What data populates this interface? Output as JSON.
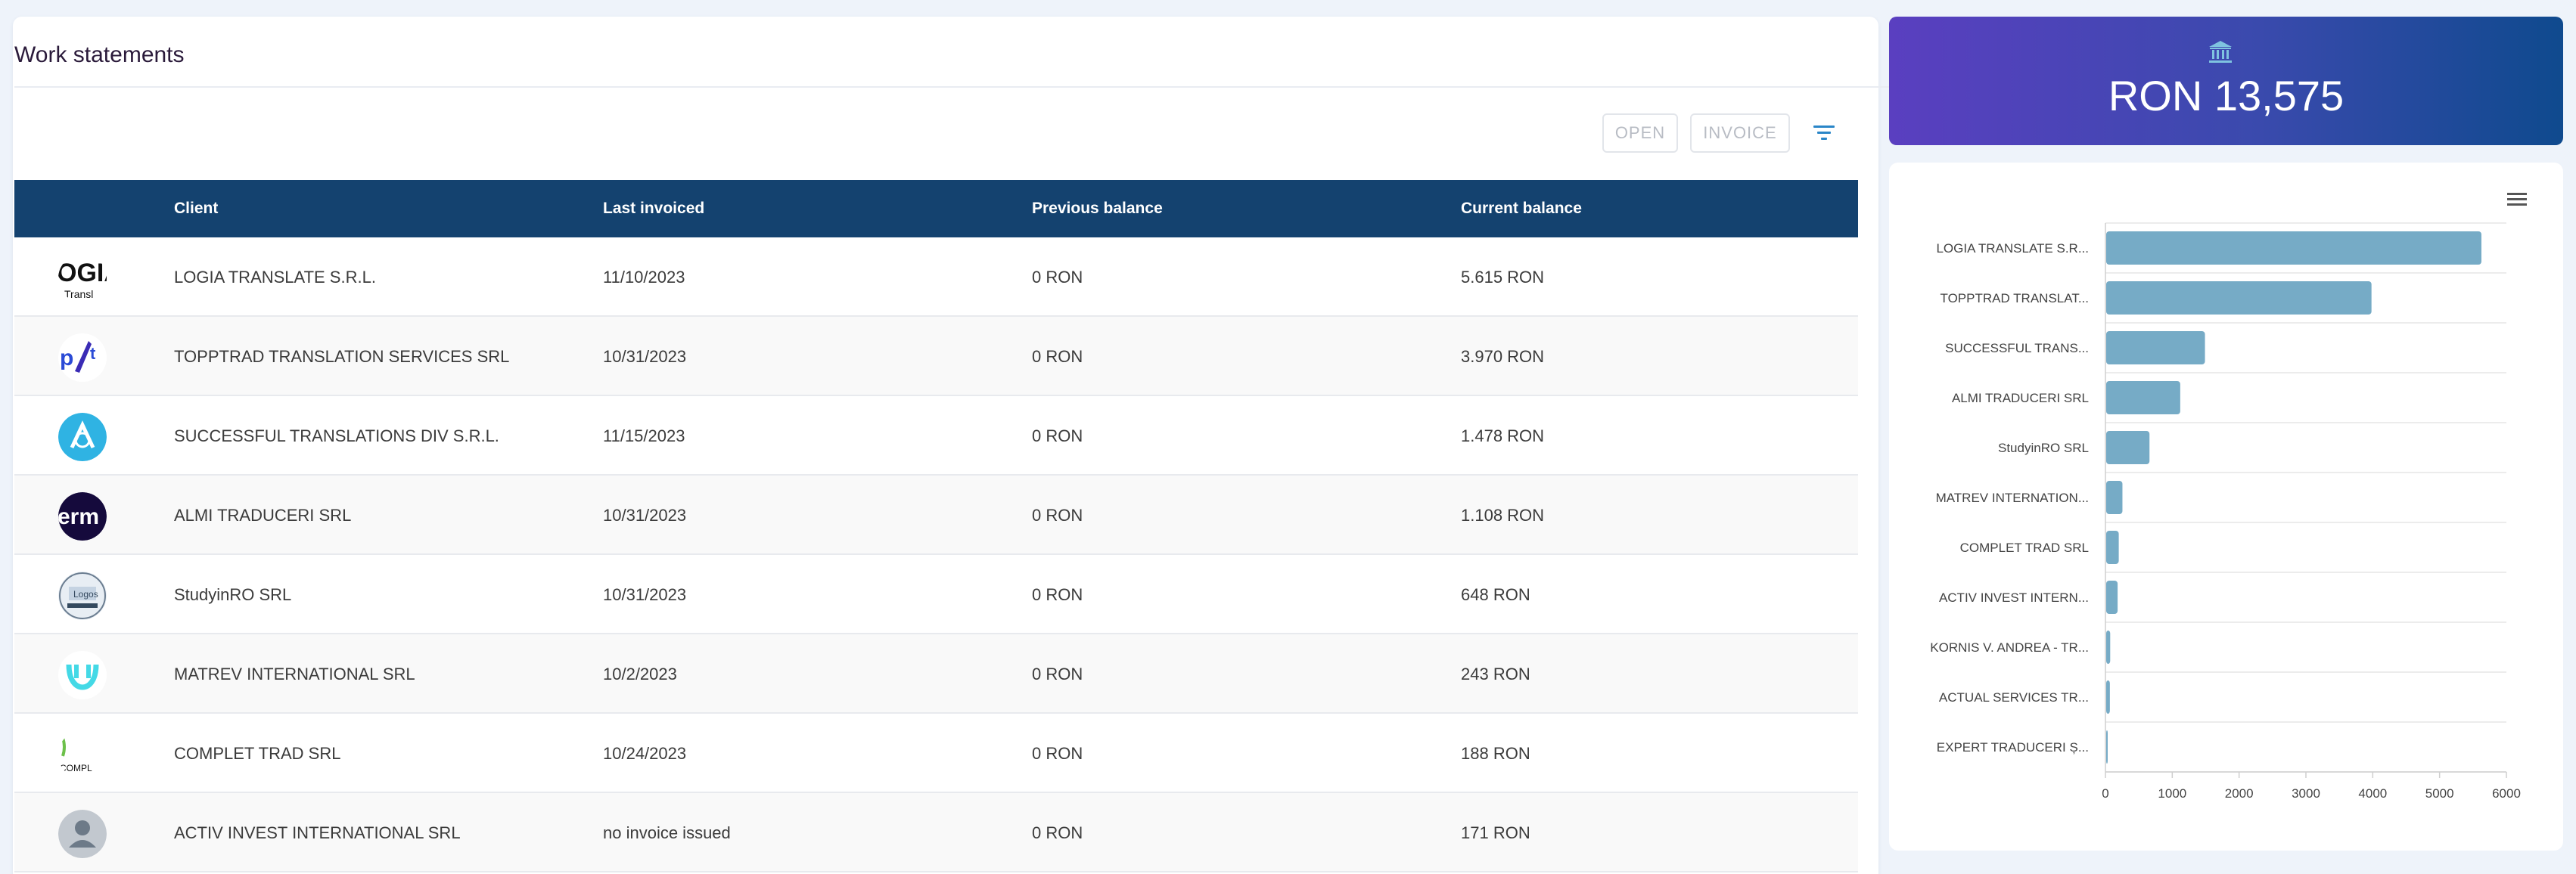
{
  "page": {
    "title": "Work statements"
  },
  "toolbar": {
    "open_label": "OPEN",
    "invoice_label": "INVOICE",
    "filter_icon": "filter-icon"
  },
  "table": {
    "headers": {
      "client": "Client",
      "last_invoiced": "Last invoiced",
      "previous_balance": "Previous balance",
      "current_balance": "Current balance"
    },
    "rows": [
      {
        "logo": "logia-logo",
        "client": "LOGIA TRANSLATE S.R.L.",
        "last_invoiced": "11/10/2023",
        "previous_balance": "0 RON",
        "current_balance": "5.615 RON"
      },
      {
        "logo": "topptrad-logo",
        "client": "TOPPTRAD TRANSLATION SERVICES SRL",
        "last_invoiced": "10/31/2023",
        "previous_balance": "0 RON",
        "current_balance": "3.970 RON"
      },
      {
        "logo": "successful-logo",
        "client": "SUCCESSFUL TRANSLATIONS DIV S.R.L.",
        "last_invoiced": "11/15/2023",
        "previous_balance": "0 RON",
        "current_balance": "1.478 RON"
      },
      {
        "logo": "almi-logo",
        "client": "ALMI TRADUCERI SRL",
        "last_invoiced": "10/31/2023",
        "previous_balance": "0 RON",
        "current_balance": "1.108 RON"
      },
      {
        "logo": "studyinro-logo",
        "client": "StudyinRO SRL",
        "last_invoiced": "10/31/2023",
        "previous_balance": "0 RON",
        "current_balance": "648 RON"
      },
      {
        "logo": "matrev-logo",
        "client": "MATREV INTERNATIONAL SRL",
        "last_invoiced": "10/2/2023",
        "previous_balance": "0 RON",
        "current_balance": "243 RON"
      },
      {
        "logo": "complet-logo",
        "client": "COMPLET TRAD SRL",
        "last_invoiced": "10/24/2023",
        "previous_balance": "0 RON",
        "current_balance": "188 RON"
      },
      {
        "logo": "default-avatar",
        "client": "ACTIV INVEST INTERNATIONAL SRL",
        "last_invoiced": "no invoice issued",
        "previous_balance": "0 RON",
        "current_balance": "171 RON"
      }
    ]
  },
  "balance": {
    "icon": "bank-icon",
    "amount": "RON 13,575"
  },
  "colors": {
    "table_header": "#14426f",
    "bar": "#76abc6",
    "gradient_start": "#5a3fc0",
    "gradient_end": "#0f4a8e"
  },
  "chart_data": {
    "type": "bar",
    "orientation": "horizontal",
    "categories": [
      "LOGIA TRANSLATE S.R...",
      "TOPPTRAD TRANSLAT...",
      "SUCCESSFUL TRANS...",
      "ALMI TRADUCERI SRL",
      "StudyinRO SRL",
      "MATREV INTERNATION...",
      "COMPLET TRAD SRL",
      "ACTIV INVEST INTERN...",
      "KORNIS V. ANDREA - TR...",
      "ACTUAL SERVICES TR...",
      "EXPERT TRADUCERI Ș..."
    ],
    "values": [
      5615,
      3970,
      1478,
      1108,
      648,
      243,
      188,
      171,
      60,
      55,
      20
    ],
    "xlim": [
      0,
      6000
    ],
    "xticks": [
      0,
      1000,
      2000,
      3000,
      4000,
      5000,
      6000
    ],
    "grid": true,
    "menu_icon": "hamburger-menu-icon"
  }
}
